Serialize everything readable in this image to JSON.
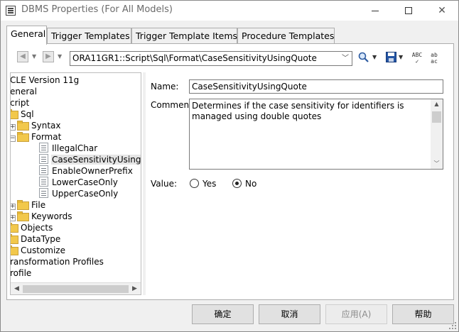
{
  "window": {
    "title": "DBMS Properties (For All Models)"
  },
  "tabs": [
    {
      "label": "General",
      "active": true
    },
    {
      "label": "Trigger Templates",
      "active": false
    },
    {
      "label": "Trigger Template Items",
      "active": false
    },
    {
      "label": "Procedure Templates",
      "active": false
    }
  ],
  "toolbar": {
    "path": "ORA11GR1::Script\\Sql\\Format\\CaseSensitivityUsingQuote",
    "find_icon": "magnifier-icon",
    "save_icon": "floppy-save-icon",
    "spell_icon": "spellcheck-icon",
    "replace_icon": "find-replace-icon"
  },
  "tree": {
    "items": [
      {
        "label": "CLE Version 11g",
        "icon": "none"
      },
      {
        "label": "eneral",
        "icon": "none"
      },
      {
        "label": "cript",
        "icon": "none"
      },
      {
        "label": "Sql",
        "icon": "folder-icon"
      },
      {
        "label": "Syntax",
        "icon": "folder-icon"
      },
      {
        "label": "Format",
        "icon": "folder-icon"
      },
      {
        "label": "IllegalChar",
        "icon": "doc-icon"
      },
      {
        "label": "CaseSensitivityUsingQuote",
        "icon": "doc-icon",
        "selected": true
      },
      {
        "label": "EnableOwnerPrefix",
        "icon": "doc-icon"
      },
      {
        "label": "LowerCaseOnly",
        "icon": "doc-icon"
      },
      {
        "label": "UpperCaseOnly",
        "icon": "doc-icon"
      },
      {
        "label": "File",
        "icon": "folder-icon"
      },
      {
        "label": "Keywords",
        "icon": "folder-icon"
      },
      {
        "label": "Objects",
        "icon": "folder-icon"
      },
      {
        "label": "DataType",
        "icon": "folder-icon"
      },
      {
        "label": "Customize",
        "icon": "folder-icon"
      },
      {
        "label": "ransformation Profiles",
        "icon": "none"
      },
      {
        "label": "rofile",
        "icon": "none"
      }
    ]
  },
  "properties": {
    "name_label": "Name:",
    "name_value": "CaseSensitivityUsingQuote",
    "comment_label": "Comment:",
    "comment_value": "Determines if the case sensitivity for identifiers is managed using double quotes",
    "value_label": "Value:",
    "yes_label": "Yes",
    "no_label": "No",
    "selected_value": "No"
  },
  "buttons": {
    "ok": "确定",
    "cancel": "取消",
    "apply": "应用(A)",
    "help": "帮助"
  }
}
